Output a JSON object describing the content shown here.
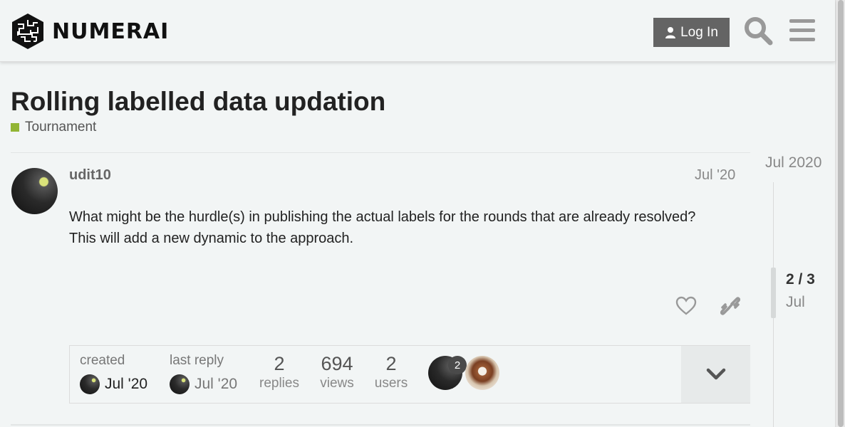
{
  "header": {
    "logo_text": "NUMERAI",
    "login_label": "Log In"
  },
  "topic": {
    "title": "Rolling labelled data updation",
    "category": "Tournament",
    "category_color": "#92b534"
  },
  "post": {
    "username": "udit10",
    "date": "Jul '20",
    "body": "What might be the hurdle(s) in publishing the actual labels for the rounds that are already resolved? This will add a new dynamic to the approach."
  },
  "topic_map": {
    "created_label": "created",
    "created_date": "Jul '20",
    "last_reply_label": "last reply",
    "last_reply_date": "Jul '20",
    "replies_count": "2",
    "replies_label": "replies",
    "views_count": "694",
    "views_label": "views",
    "users_count": "2",
    "users_label": "users",
    "participant_badge": "2"
  },
  "timeline": {
    "top_date": "Jul 2020",
    "position": "2 / 3",
    "month": "Jul"
  },
  "icons": {
    "logo": "numerai-logo-icon",
    "user": "user-icon",
    "search": "search-icon",
    "menu": "hamburger-menu-icon",
    "like": "heart-icon",
    "link": "link-icon",
    "expand": "chevron-down-icon"
  }
}
